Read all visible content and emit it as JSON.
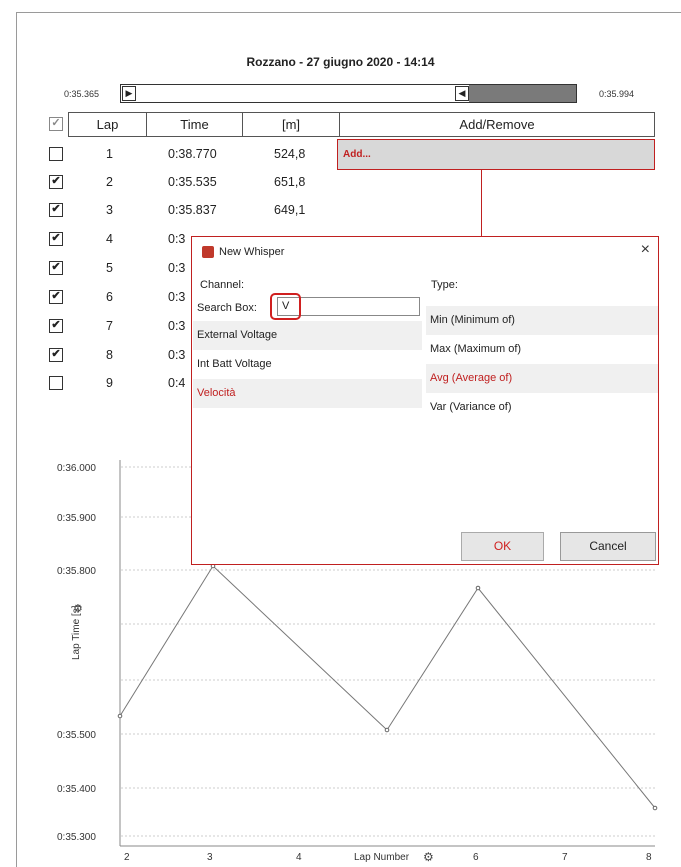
{
  "header": {
    "title": "Rozzano - 27 giugno 2020 - 14:14"
  },
  "range": {
    "start": "0:35.365",
    "end": "0:35.994",
    "left_arrow": "▶",
    "right_arrow": "◀"
  },
  "table": {
    "columns": [
      "Lap",
      "Time",
      "[m]",
      "Add/Remove"
    ],
    "header_checked": "✓",
    "rows": [
      {
        "checked": "",
        "lap": "1",
        "time": "0:38.770",
        "m": "524,8"
      },
      {
        "checked": "✔",
        "lap": "2",
        "time": "0:35.535",
        "m": "651,8"
      },
      {
        "checked": "✔",
        "lap": "3",
        "time": "0:35.837",
        "m": "649,1"
      },
      {
        "checked": "✔",
        "lap": "4",
        "time": "0:3",
        "m": ""
      },
      {
        "checked": "✔",
        "lap": "5",
        "time": "0:3",
        "m": ""
      },
      {
        "checked": "✔",
        "lap": "6",
        "time": "0:3",
        "m": ""
      },
      {
        "checked": "✔",
        "lap": "7",
        "time": "0:3",
        "m": ""
      },
      {
        "checked": "✔",
        "lap": "8",
        "time": "0:3",
        "m": ""
      },
      {
        "checked": "",
        "lap": "9",
        "time": "0:4",
        "m": ""
      }
    ],
    "add_label": "Add..."
  },
  "dialog": {
    "title": "New Whisper",
    "close": "×",
    "channel_label": "Channel:",
    "type_label": "Type:",
    "search_label": "Search Box:",
    "search_value": "V",
    "channels": [
      "External Voltage",
      "Int Batt Voltage",
      "Velocità"
    ],
    "selected_channel": "Velocità",
    "types": [
      "Min (Minimum of)",
      "Max (Maximum of)",
      "Avg (Average of)",
      "Var (Variance of)"
    ],
    "selected_type": "Avg (Average of)",
    "ok_label": "OK",
    "cancel_label": "Cancel"
  },
  "colors": {
    "accent": "#c02020",
    "selected_row": "#f0f0f0"
  },
  "chart_data": {
    "type": "line",
    "xlabel": "Lap Number",
    "ylabel": "Lap Time [s]",
    "y_ticks": [
      "0:35.300",
      "0:35.400",
      "0:35.500",
      "0:35.800",
      "0:35.900",
      "0:36.000"
    ],
    "x_ticks": [
      "2",
      "3",
      "4",
      "6",
      "7",
      "8"
    ],
    "series": [
      {
        "points": [
          [
            2,
            0.53
          ],
          [
            3,
            0.83
          ],
          [
            5,
            0.51
          ],
          [
            6,
            0.77
          ],
          [
            8,
            0.36
          ]
        ]
      }
    ]
  }
}
